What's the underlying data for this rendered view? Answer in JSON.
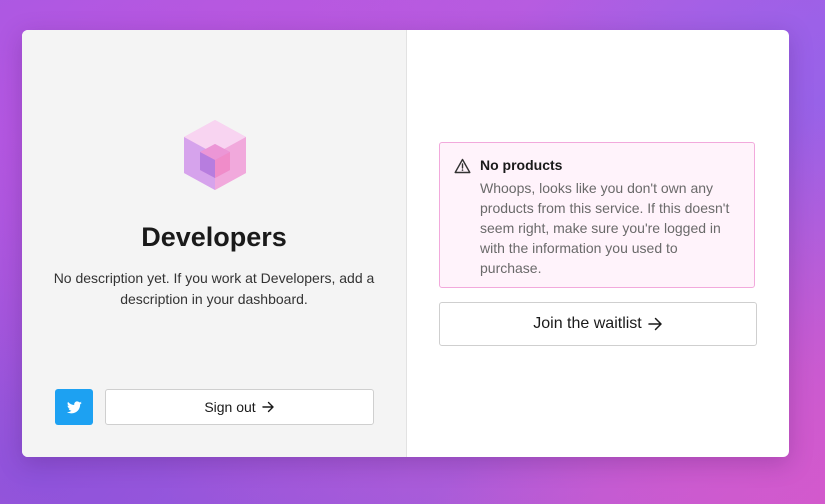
{
  "brand": {
    "name": "Developers",
    "description": "No description yet. If you work at Developers, add a description in your dashboard.",
    "logo_icon": "cube-icon"
  },
  "footer": {
    "twitter_icon": "twitter-icon",
    "sign_out_label": "Sign out"
  },
  "alert": {
    "icon": "warning-triangle-icon",
    "title": "No products",
    "message": "Whoops, looks like you don't own any products from this service. If this doesn't seem right, make sure you're logged in with the information you used to purchase."
  },
  "actions": {
    "waitlist_label": "Join the waitlist"
  },
  "colors": {
    "twitter": "#1da1f2",
    "alert_background": "#fff3fb",
    "alert_border": "#f2a9dc"
  }
}
